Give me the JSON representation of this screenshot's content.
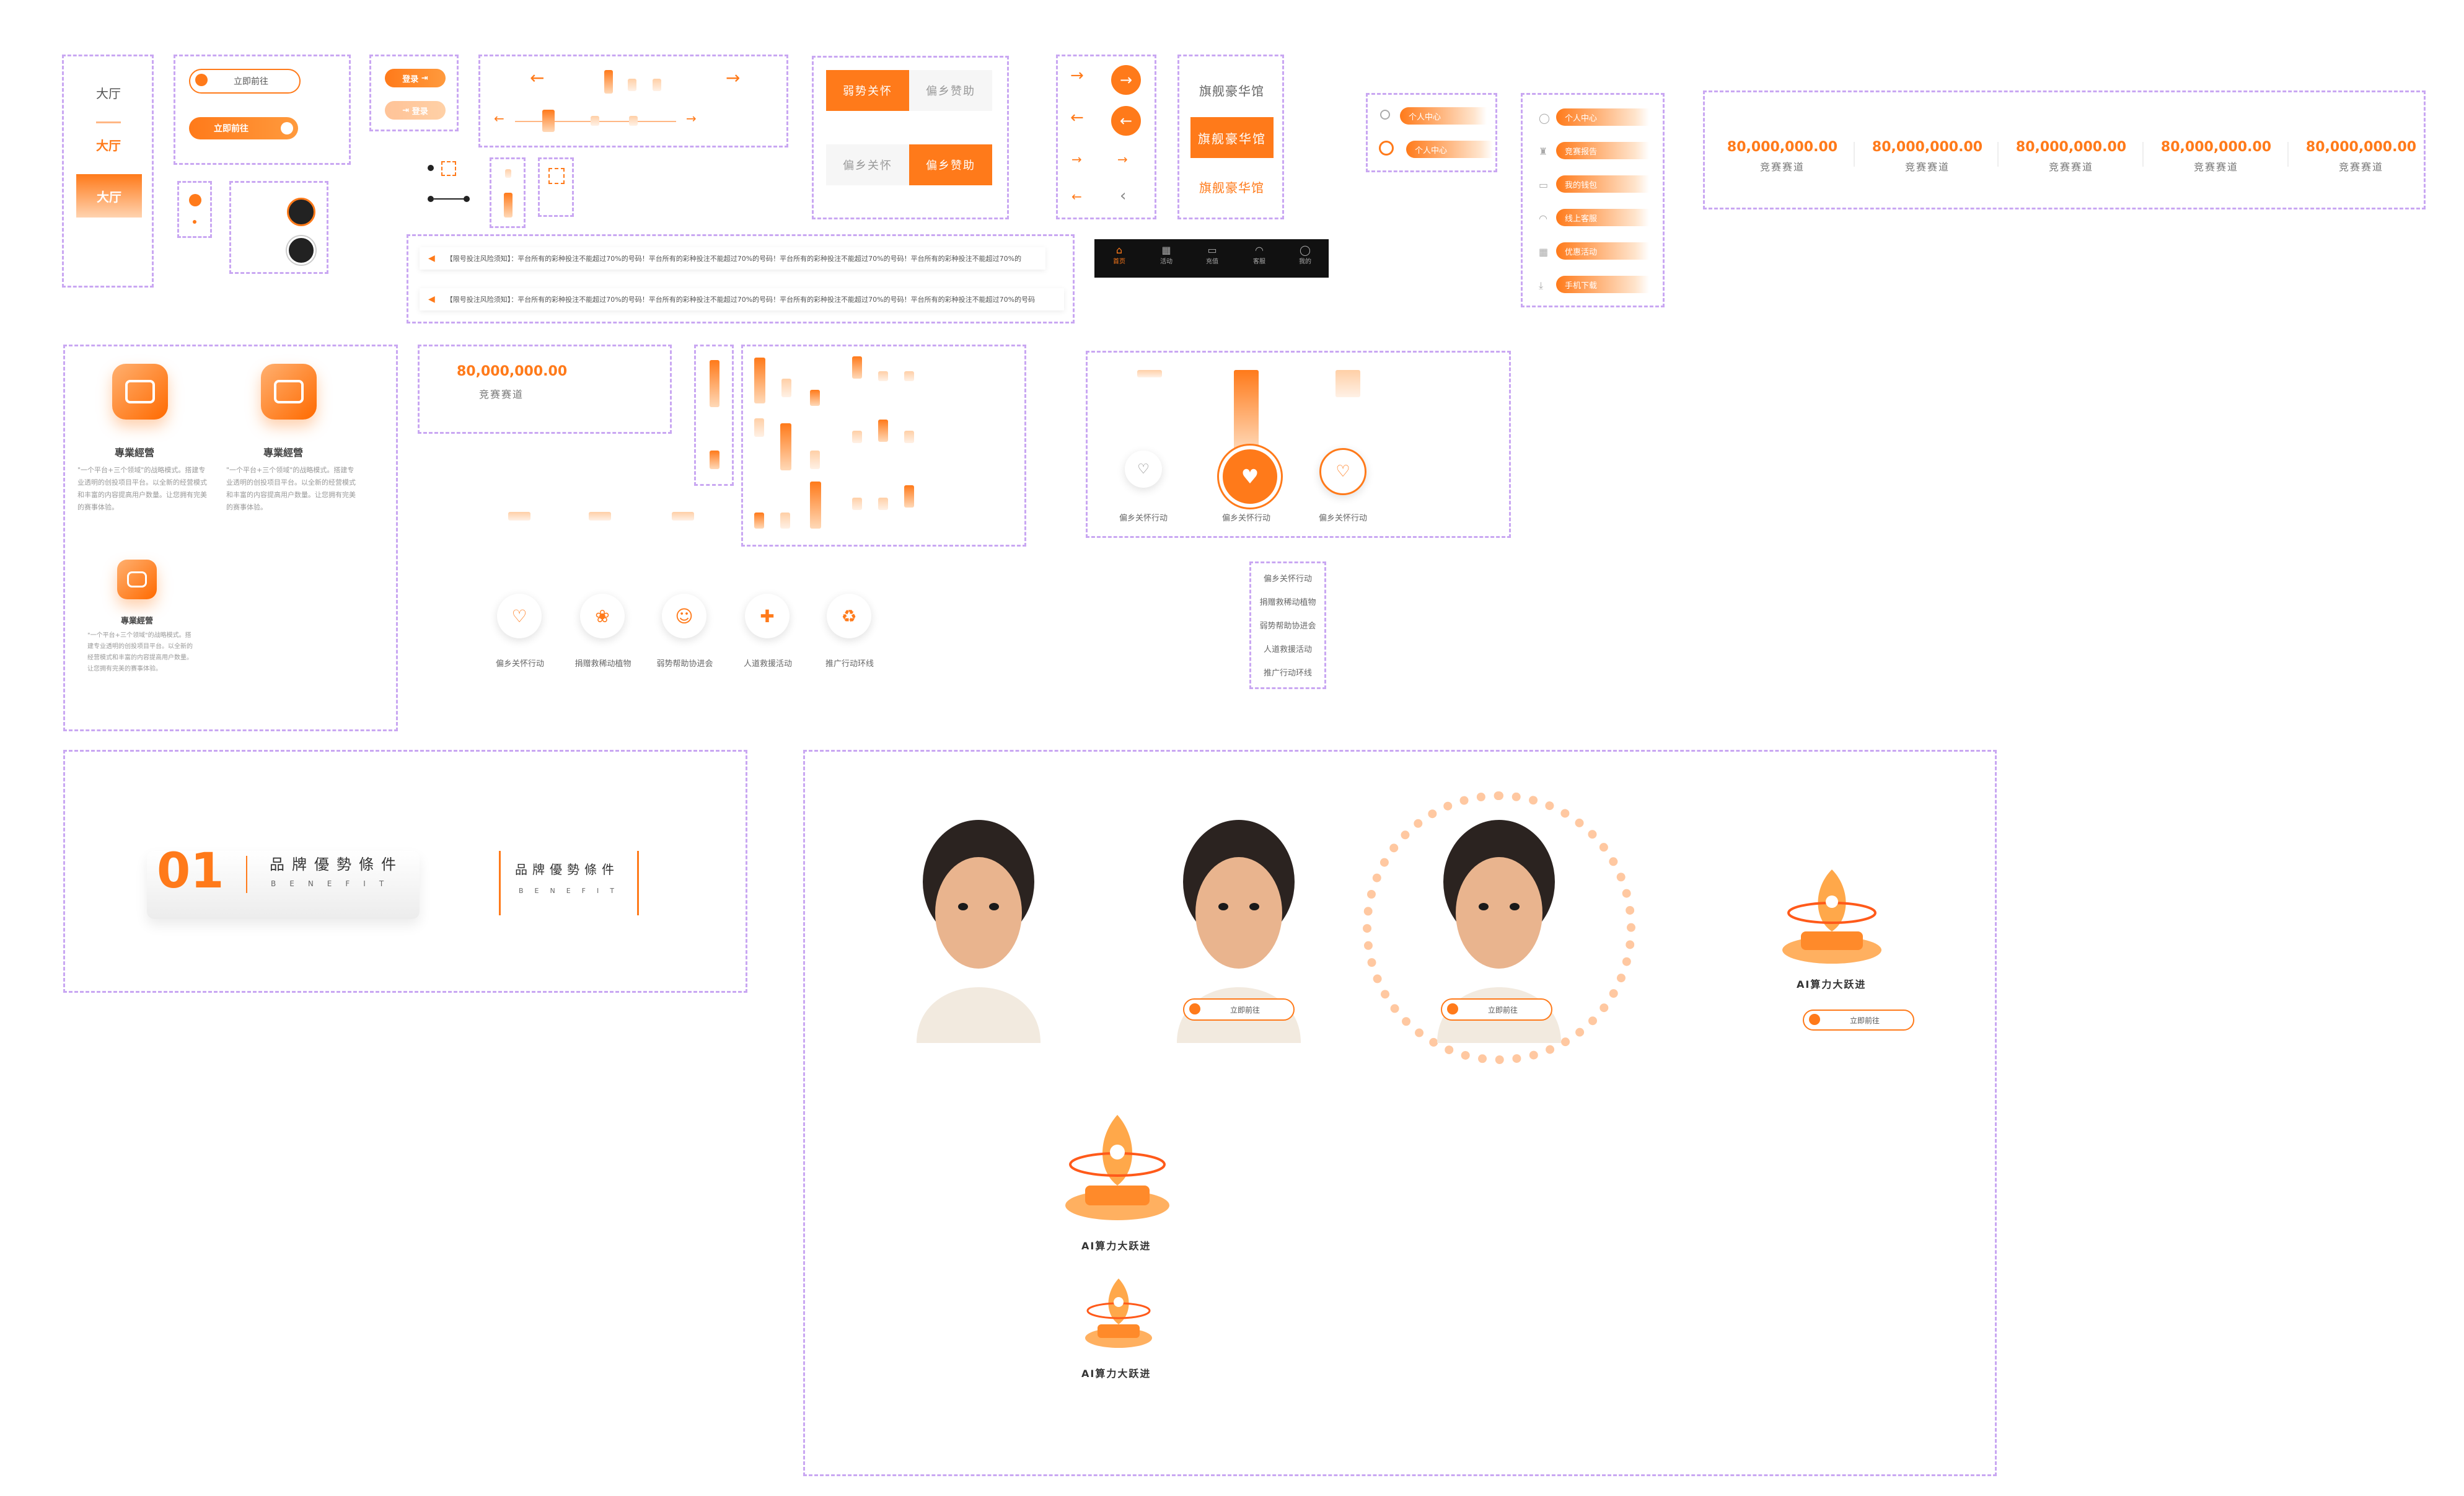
{
  "hall": {
    "label_top": "大厅",
    "label_mid": "大厅",
    "label_active": "大厅"
  },
  "buttons": {
    "go_now": "立即前往",
    "login": "登录",
    "login_disabled": "登录"
  },
  "tabs": {
    "weak_care": "弱势关怀",
    "rural_support": "偏乡赞助",
    "rural_care_disabled": "偏乡关怀",
    "rural_support_active": "偏乡赞助"
  },
  "flagship": {
    "title": "旗舰豪华馆",
    "active": "旗舰豪华馆",
    "link": "旗舰豪华馆"
  },
  "personal": {
    "item1": "个人中心",
    "item2": "个人中心"
  },
  "sidebar_menu": {
    "items": [
      {
        "label": "个人中心",
        "icon": "user-icon"
      },
      {
        "label": "竞赛报告",
        "icon": "trophy-icon"
      },
      {
        "label": "我的钱包",
        "icon": "wallet-icon"
      },
      {
        "label": "线上客服",
        "icon": "headset-icon"
      },
      {
        "label": "优惠活动",
        "icon": "gift-icon"
      },
      {
        "label": "手机下载",
        "icon": "download-icon"
      }
    ]
  },
  "stats": {
    "items": [
      {
        "value": "80,000,000.00",
        "label": "竞赛赛道"
      },
      {
        "value": "80,000,000.00",
        "label": "竞赛赛道"
      },
      {
        "value": "80,000,000.00",
        "label": "竞赛赛道"
      },
      {
        "value": "80,000,000.00",
        "label": "竞赛赛道"
      },
      {
        "value": "80,000,000.00",
        "label": "竞赛赛道"
      }
    ]
  },
  "notices": {
    "line1": "【限号投注风险须知】：平台所有的彩种投注不能超过70%的号码！平台所有的彩种投注不能超过70%的号码！平台所有的彩种投注不能超过70%的号码！平台所有的彩种投注不能超过70%的",
    "line2": "【限号投注风险须知】：平台所有的彩种投注不能超过70%的号码！平台所有的彩种投注不能超过70%的号码！平台所有的彩种投注不能超过70%的号码！平台所有的彩种投注不能超过70%的号码"
  },
  "bottom_nav": {
    "items": [
      {
        "label": "首页",
        "icon": "home-icon"
      },
      {
        "label": "活动",
        "icon": "gift-icon"
      },
      {
        "label": "充值",
        "icon": "wallet-icon"
      },
      {
        "label": "客服",
        "icon": "headset-icon"
      },
      {
        "label": "我的",
        "icon": "user-icon"
      }
    ]
  },
  "pro_cards": {
    "title": "專業經營",
    "desc": "\"一个平台+三个领域\"的战略模式。搭建专业透明的创投项目平台。以全新的经营模式和丰富的内容提高用户数量。让您拥有完美的赛事体验。"
  },
  "single_stat": {
    "value": "80,000,000.00",
    "label": "竞赛赛道"
  },
  "charity": {
    "items": [
      "偏乡关怀行动",
      "偏乡关怀行动",
      "偏乡关怀行动"
    ]
  },
  "charity_row": {
    "items": [
      {
        "label": "偏乡关怀行动",
        "icon": "heart-icon"
      },
      {
        "label": "捐赠救稀动植物",
        "icon": "plant-icon"
      },
      {
        "label": "弱势帮助协进会",
        "icon": "hands-icon"
      },
      {
        "label": "人道救援活动",
        "icon": "aid-icon"
      },
      {
        "label": "推广行动环线",
        "icon": "recycle-icon"
      }
    ]
  },
  "charity_list": {
    "items": [
      "偏乡关怀行动",
      "捐赠救稀动植物",
      "弱势帮助协进会",
      "人道救援活动",
      "推广行动环线"
    ]
  },
  "brand": {
    "number": "01",
    "title": "品牌優勢條件",
    "subtitle": "BENEFIT",
    "title2": "品牌優勢條件",
    "subtitle2": "BENEFIT"
  },
  "showcase": {
    "ai_title": "AI算力大跃进",
    "go_now": "立即前往"
  },
  "colors": {
    "accent": "#ff7a1a",
    "border": "#c9a7f2"
  }
}
